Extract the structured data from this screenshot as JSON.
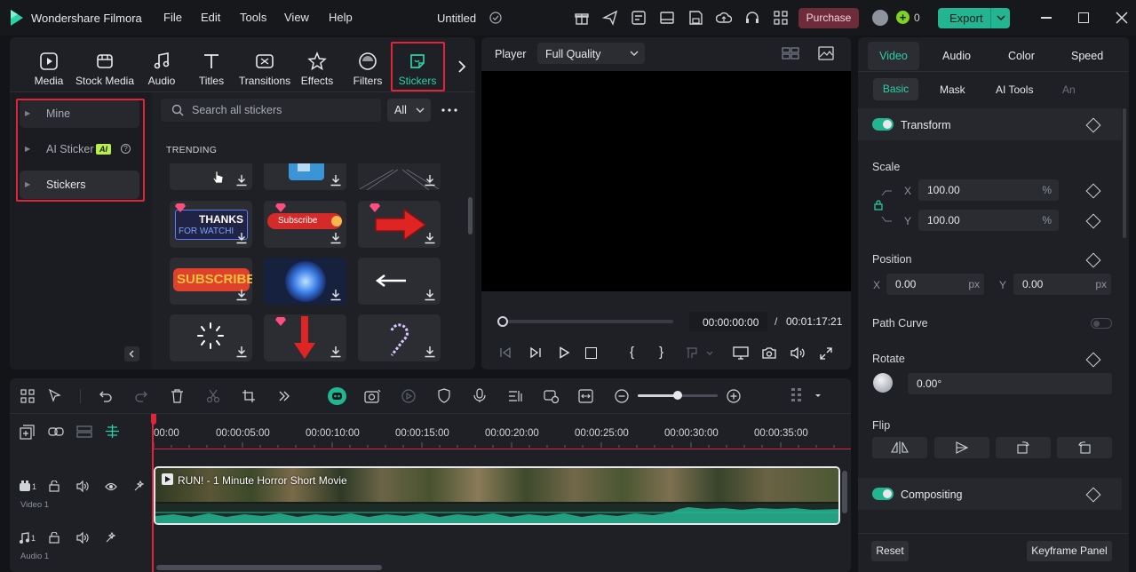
{
  "app": {
    "title": "Wondershare Filmora",
    "project": "Untitled"
  },
  "menu": [
    "File",
    "Edit",
    "Tools",
    "View",
    "Help"
  ],
  "header": {
    "purchase_label": "Purchase",
    "credits": "0",
    "export_label": "Export"
  },
  "tool_tabs": [
    {
      "label": "Media",
      "icon": "media-icon"
    },
    {
      "label": "Stock Media",
      "icon": "stock-media-icon"
    },
    {
      "label": "Audio",
      "icon": "audio-icon"
    },
    {
      "label": "Titles",
      "icon": "titles-icon"
    },
    {
      "label": "Transitions",
      "icon": "transitions-icon"
    },
    {
      "label": "Effects",
      "icon": "effects-icon"
    },
    {
      "label": "Filters",
      "icon": "filters-icon"
    },
    {
      "label": "Stickers",
      "icon": "stickers-icon"
    }
  ],
  "sidebar": {
    "items": [
      {
        "label": "Mine"
      },
      {
        "label": "AI Sticker",
        "badge": "AI"
      },
      {
        "label": "Stickers"
      }
    ]
  },
  "stickers": {
    "search_placeholder": "Search all stickers",
    "filter_value": "All",
    "section": "TRENDING",
    "thumb_text": {
      "thanks_1": "THANKS",
      "thanks_2": "FOR WATCHI",
      "subscribe_small": "Subscribe",
      "subscribe_big": "SUBSCRIBE"
    }
  },
  "player": {
    "label": "Player",
    "quality": "Full Quality",
    "current_time": "00:00:00:00",
    "separator": "/",
    "total_time": "00:01:17:21",
    "progress": 0
  },
  "properties": {
    "tabs": [
      "Video",
      "Audio",
      "Color",
      "Speed"
    ],
    "subtabs": [
      "Basic",
      "Mask",
      "AI Tools",
      "An"
    ],
    "transform_label": "Transform",
    "scale_label": "Scale",
    "scale_x_label": "X",
    "scale_x": "100.00",
    "scale_y_label": "Y",
    "scale_y": "100.00",
    "percent": "%",
    "position_label": "Position",
    "pos_x_label": "X",
    "pos_x": "0.00",
    "pos_y_label": "Y",
    "pos_y": "0.00",
    "px": "px",
    "path_curve_label": "Path Curve",
    "rotate_label": "Rotate",
    "rotate_value": "0.00°",
    "flip_label": "Flip",
    "compositing_label": "Compositing",
    "reset_label": "Reset",
    "keyframe_panel_label": "Keyframe Panel"
  },
  "timeline": {
    "ticks": [
      "00:00",
      "00:00:05:00",
      "00:00:10:00",
      "00:00:15:00",
      "00:00:20:00",
      "00:00:25:00",
      "00:00:30:00",
      "00:00:35:00"
    ],
    "clip_title": "RUN! - 1 Minute Horror Short Movie",
    "video_track_label": "Video 1",
    "video_track_num": "1",
    "audio_track_label": "Audio 1",
    "audio_track_num": "1"
  },
  "colors": {
    "accent": "#23b592",
    "highlight": "#e0253a",
    "purchase": "#6e2b3a",
    "playhead": "#e0253a"
  }
}
